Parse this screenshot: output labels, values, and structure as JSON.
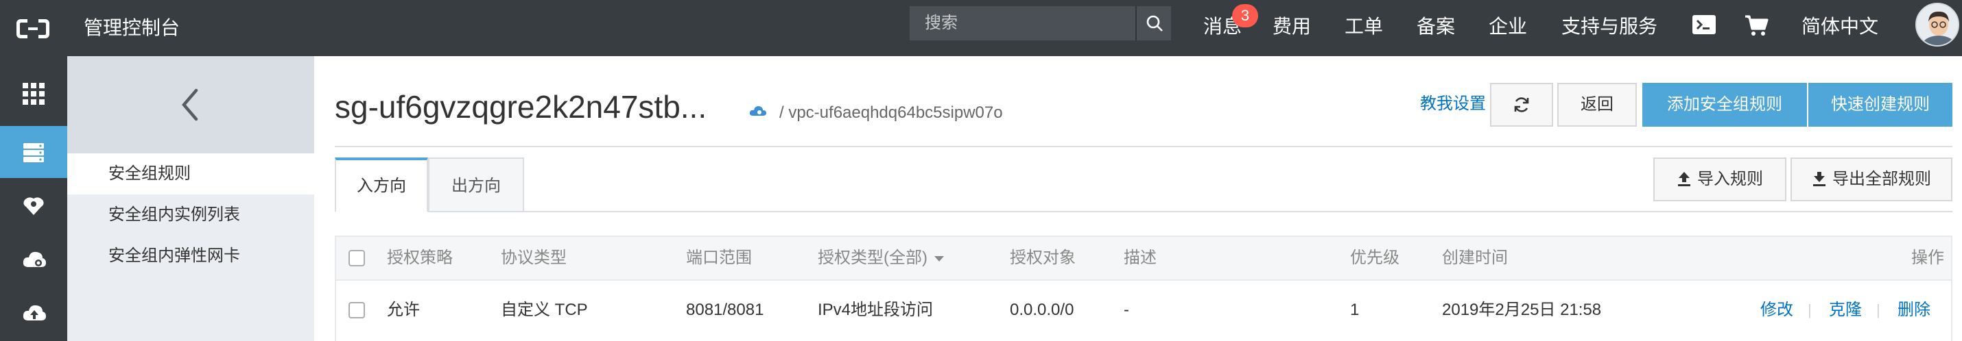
{
  "topbar": {
    "console_title": "管理控制台",
    "search_placeholder": "搜索",
    "nav": {
      "messages": "消息",
      "messages_badge": "3",
      "billing": "费用",
      "tickets": "工单",
      "icp": "备案",
      "enterprise": "企业",
      "support": "支持与服务",
      "language": "简体中文"
    },
    "icons": [
      "aliyun-logo",
      "search-icon",
      "terminal-icon",
      "cart-icon",
      "avatar"
    ]
  },
  "rail": {
    "icons": [
      "grid-icon",
      "server-icon",
      "network-icon",
      "cloud-icon",
      "cloud-upload-icon"
    ],
    "active_index": 1
  },
  "sidebar": {
    "items": [
      {
        "label": "安全组规则"
      },
      {
        "label": "安全组内实例列表"
      },
      {
        "label": "安全组内弹性网卡"
      }
    ],
    "active_index": 0
  },
  "header": {
    "title": "sg-uf6gvzqgre2k2n47stb...",
    "vpc": "/ vpc-uf6aeqhdq64bc5sipw07o",
    "help_link": "教我设置",
    "back_label": "返回",
    "add_rule_label": "添加安全组规则",
    "quick_create_label": "快速创建规则"
  },
  "tabs": [
    {
      "label": "入方向"
    },
    {
      "label": "出方向"
    }
  ],
  "toolbar": {
    "import_label": "导入规则",
    "export_label": "导出全部规则"
  },
  "table": {
    "columns": [
      "授权策略",
      "协议类型",
      "端口范围",
      "授权类型(全部)",
      "授权对象",
      "描述",
      "优先级",
      "创建时间",
      "操作"
    ],
    "rows": [
      {
        "policy": "允许",
        "protocol": "自定义 TCP",
        "port": "8081/8081",
        "auth_type": "IPv4地址段访问",
        "auth_object": "0.0.0.0/0",
        "description": "-",
        "priority": "1",
        "created": "2019年2月25日 21:58",
        "actions": {
          "edit": "修改",
          "clone": "克隆",
          "delete": "删除"
        }
      }
    ]
  },
  "colors": {
    "topbar_bg": "#373d41",
    "accent": "#4fa6d8",
    "link": "#0073c6",
    "badge": "#ff5a4f"
  }
}
